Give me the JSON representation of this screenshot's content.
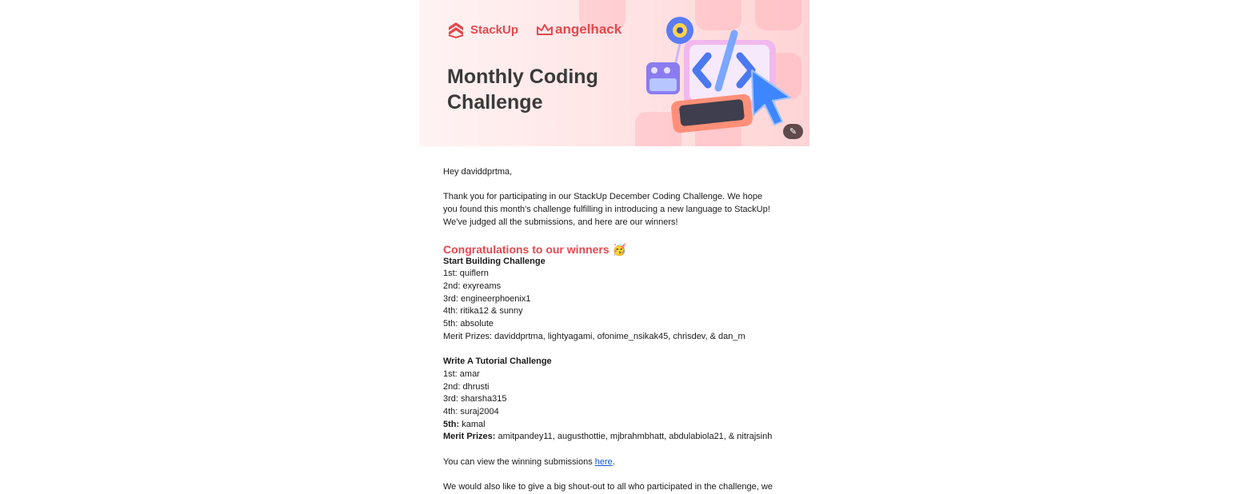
{
  "banner": {
    "brand_stackup": "StackUp",
    "brand_angelhack": "angelhack",
    "title_line1": "Monthly Coding",
    "title_line2": "Challenge",
    "expand_icon": "magic-wand-icon"
  },
  "email": {
    "greeting": "Hey daviddprtma,",
    "intro": [
      "Thank you for participating in our StackUp December Coding Challenge. We hope",
      "you found this month's challenge fulfilling in introducing a new language to StackUp!",
      "We've judged all the submissions, and here are our winners!"
    ],
    "congrats_heading": "Congratulations to our winners",
    "congrats_emoji": "🥳",
    "challenge1": {
      "title": "Start Building Challenge",
      "places": [
        "1st: quiflern",
        "2nd: exyreams",
        "3rd: engineerphoenix1",
        "4th: ritika12 & sunny",
        "5th: absolute"
      ],
      "merit": "Merit Prizes: daviddprtma, lightyagami, ofonime_nsikak45, chrisdev, & dan_m"
    },
    "challenge2": {
      "title": "Write A Tutorial Challenge",
      "places": [
        "1st: amar",
        "2nd: dhrusti",
        "3rd: sharsha315",
        "4th: suraj2004"
      ],
      "fifth_label": "5th:",
      "fifth_value": " kamal",
      "merit_label": "Merit Prizes:",
      "merit_value": " amitpandey11, augusthottie, mjbrahmbhatt, abdulabiola21, & nitrajsinh"
    },
    "view_text": "You can view the winning submissions ",
    "view_link": "here",
    "view_end": ".",
    "shoutout": "We would also like to give a big shout-out to all who participated in the challenge, we"
  }
}
